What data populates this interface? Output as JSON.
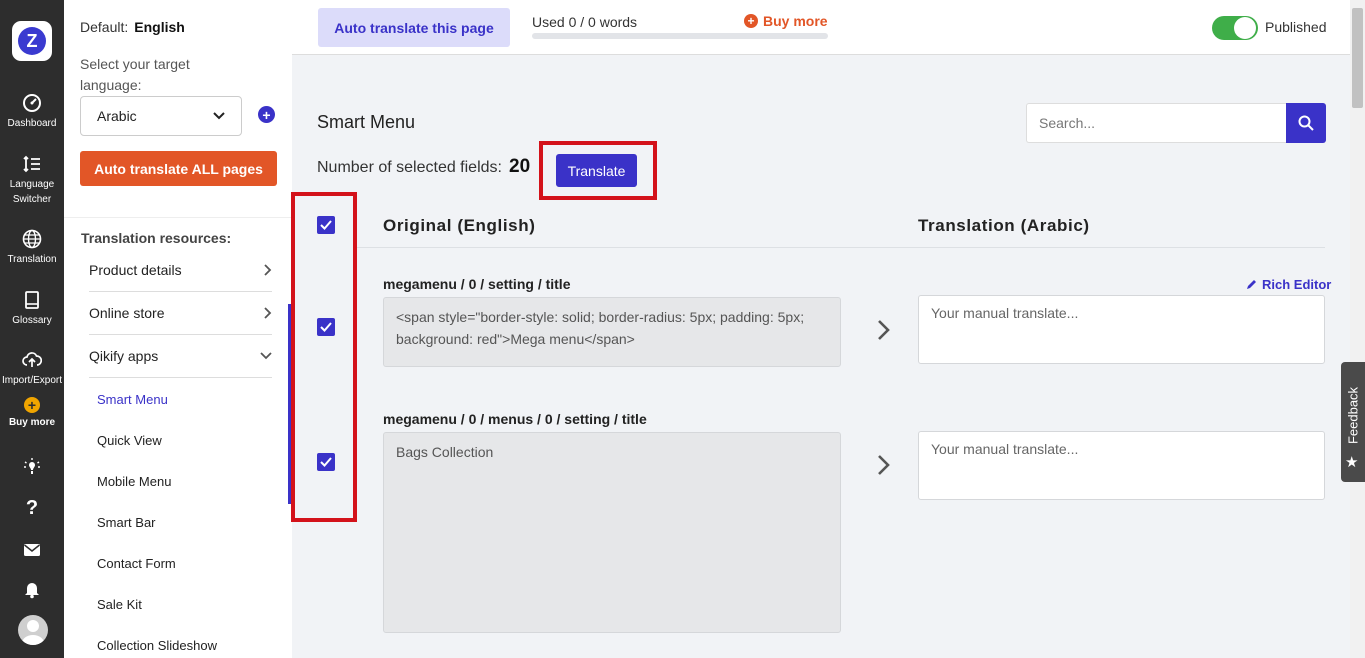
{
  "rail": {
    "logo_letter": "Z",
    "items": [
      {
        "label": "Dashboard",
        "icon": "dashboard-icon"
      },
      {
        "label": "Language Switcher",
        "icon": "language-switcher-icon"
      },
      {
        "label": "Translation",
        "icon": "globe-icon"
      },
      {
        "label": "Glossary",
        "icon": "book-icon"
      },
      {
        "label": "Import/Export",
        "icon": "cloud-upload-icon"
      },
      {
        "label": "Buy more",
        "icon": "plus-circle-icon"
      }
    ],
    "bottom_icons": [
      "lightbulb-icon",
      "help-icon",
      "mail-icon",
      "bell-icon",
      "avatar"
    ]
  },
  "sidebar": {
    "default_label": "Default:",
    "default_value": "English",
    "select_label": "Select your target language:",
    "select_value": "Arabic",
    "add_icon": "plus-circle-icon",
    "auto_all_label": "Auto translate ALL pages",
    "resources_title": "Translation resources:",
    "items": [
      {
        "label": "Product details",
        "chevron": "›"
      },
      {
        "label": "Online store",
        "chevron": "›"
      },
      {
        "label": "Qikify apps",
        "chevron": "⌄"
      }
    ],
    "sub_items": [
      "Smart Menu",
      "Quick View",
      "Mobile Menu",
      "Smart Bar",
      "Contact Form",
      "Sale Kit",
      "Collection Slideshow"
    ],
    "active_sub": "Smart Menu"
  },
  "topbar": {
    "auto_page_label": "Auto translate this page",
    "used_text": "Used 0 / 0 words",
    "usage_fraction": 0,
    "buy_more_label": "Buy more",
    "published_label": "Published",
    "published_on": true
  },
  "main": {
    "title": "Smart Menu",
    "search_placeholder": "Search...",
    "selected_label": "Number of selected fields:",
    "selected_count": "20",
    "translate_button": "Translate",
    "col_original": "Original (English)",
    "col_translation": "Translation (Arabic)",
    "rich_editor": "Rich Editor",
    "fields": [
      {
        "label": "megamenu / 0 / setting / title",
        "original": "<span style=\"border-style: solid; border-radius: 5px; padding: 5px; background: red\">Mega menu</span>",
        "placeholder": "Your manual translate...",
        "checked": true
      },
      {
        "label": "megamenu / 0 / menus / 0 / setting / title",
        "original": "Bags Collection",
        "placeholder": "Your manual translate...",
        "checked": true
      }
    ]
  },
  "feedback_label": "Feedback",
  "colors": {
    "accent": "#3a32c8",
    "orange": "#e25627",
    "highlight": "#d3121a",
    "toggle_on": "#3fae49",
    "rail_bg": "#2d2d2d"
  }
}
